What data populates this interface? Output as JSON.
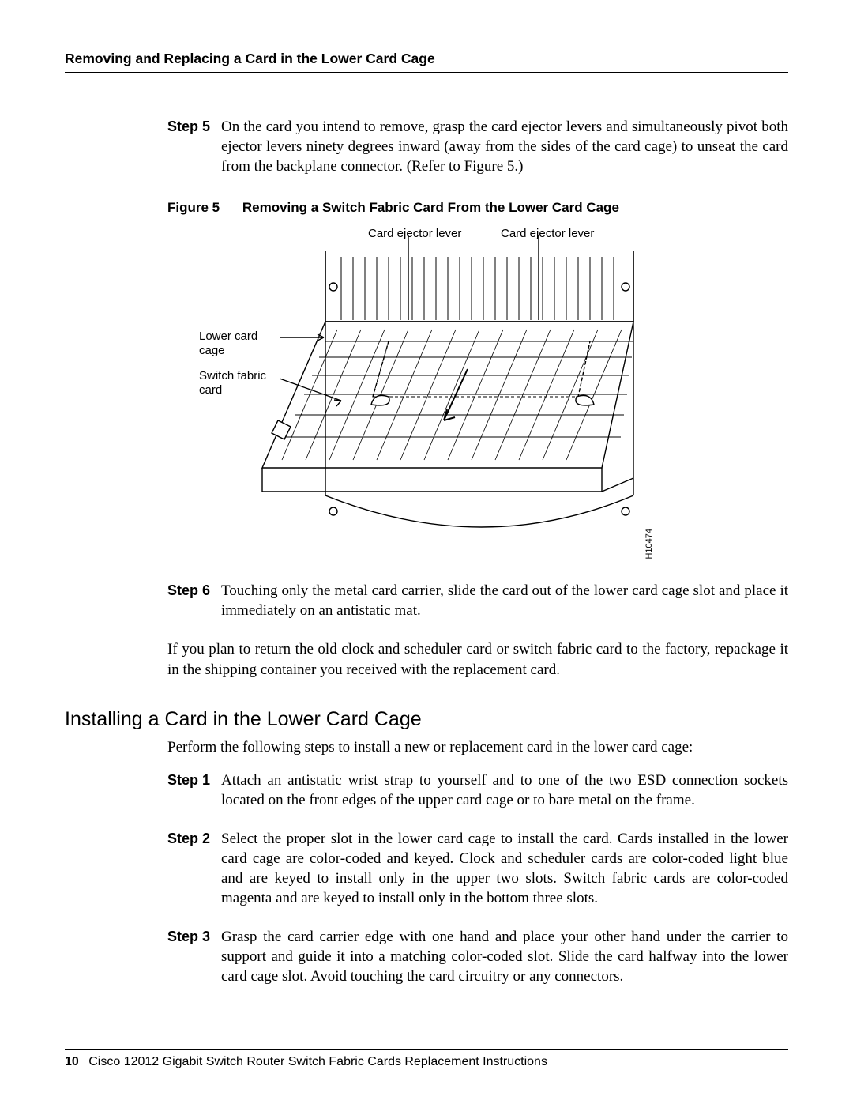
{
  "running_head": "Removing and Replacing a Card in the Lower Card Cage",
  "step5": {
    "label": "Step 5",
    "text": "On the card you intend to remove, grasp the card ejector levers and simultaneously pivot both ejector levers ninety degrees inward (away from the sides of the card cage) to unseat the card from the backplane connector. (Refer to Figure 5.)"
  },
  "figure": {
    "number": "Figure 5",
    "title": "Removing a Switch Fabric Card From the Lower Card Cage",
    "labels": {
      "ejector_left": "Card ejector lever",
      "ejector_right": "Card ejector lever",
      "lower_cage": "Lower card\ncage",
      "switch_card": "Switch fabric\ncard"
    },
    "id": "H10474"
  },
  "step6": {
    "label": "Step 6",
    "text": "Touching only the metal card carrier, slide the card out of the lower card cage slot and place it immediately on an antistatic mat."
  },
  "return_note": "If you plan to return the old clock and scheduler card or switch fabric card to the factory, repackage it in the shipping container you received with the replacement card.",
  "section2": {
    "heading": "Installing a Card in the Lower Card Cage",
    "intro": "Perform the following steps to install a new or replacement card in the lower card cage:",
    "steps": [
      {
        "label": "Step 1",
        "text": "Attach an antistatic wrist strap to yourself and to one of the two ESD connection sockets located on the front edges of the upper card cage or to bare metal on the frame."
      },
      {
        "label": "Step 2",
        "text": "Select the proper slot in the lower card cage to install the card. Cards installed in the lower card cage are color-coded and keyed. Clock and scheduler cards are color-coded light blue and are keyed to install only in the upper two slots. Switch fabric cards are color-coded magenta and are keyed to install only in the bottom three slots."
      },
      {
        "label": "Step 3",
        "text": "Grasp the card carrier edge with one hand and place your other hand under the carrier to support and guide it into a matching color-coded slot. Slide the card halfway into the lower card cage slot. Avoid touching the card circuitry or any connectors."
      }
    ]
  },
  "footer": {
    "page_number": "10",
    "doc_title": "Cisco 12012 Gigabit Switch Router Switch Fabric Cards Replacement Instructions"
  }
}
